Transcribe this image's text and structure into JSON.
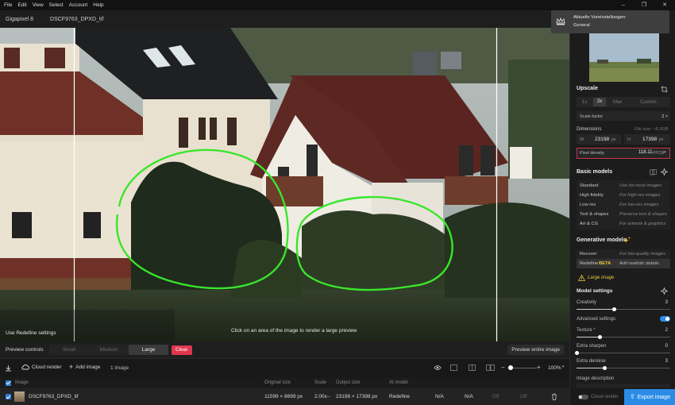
{
  "menu": [
    "File",
    "Edit",
    "View",
    "Select",
    "Account",
    "Help"
  ],
  "window_controls": [
    "–",
    "❐",
    "✕"
  ],
  "app": {
    "name": "Gigapixel 8",
    "filename": "DSCF9763_DPXD_tif"
  },
  "toast": {
    "title": "Aktuelle Voreinstellungen:",
    "subtitle": "General"
  },
  "preview": {
    "bottom_left_hint": "Use Redefine settings",
    "center_hint": "Click on an area of the image to render a large preview"
  },
  "preview_controls": {
    "label": "Preview controls",
    "sizes": [
      "Small",
      "Medium",
      "Large"
    ],
    "active_size": "Large",
    "clear": "Clear",
    "preview_entire": "Preview entire image"
  },
  "toolbar": {
    "cloud_render": "Cloud render",
    "add_image": "Add image",
    "count": "1 image",
    "zoom": "100%"
  },
  "table": {
    "headers": [
      "Image",
      "Original size",
      "Scale",
      "Output size",
      "AI model"
    ],
    "row": {
      "name": "DSCF9763_DPXD_tif",
      "original": "11599 × 8699 px",
      "scale": "2.00x",
      "output": "23198 × 17398 px",
      "model": "Redefine",
      "c1": "N/A",
      "c2": "N/A",
      "c3": "Off",
      "c4": "Off"
    }
  },
  "panel": {
    "upscale_title": "Upscale",
    "scale_options": [
      "1x",
      "2x",
      "Max",
      "Custom"
    ],
    "active_scale": "2x",
    "scale_factor_label": "Scale factor",
    "scale_factor_value": "2 ×",
    "dimensions_label": "Dimensions",
    "file_size": "File size: ~8.2GB",
    "w_label": "W",
    "w_value": "23198",
    "h_label": "H",
    "h_value": "17398",
    "unit": "px",
    "pixel_density_label": "Pixel density",
    "pixel_density_value": "118.11",
    "pixel_density_unit": "PPCM",
    "basic_title": "Basic models",
    "basic_models": [
      {
        "name": "Standard",
        "desc": "Use for most images"
      },
      {
        "name": "High fidelity",
        "desc": "For high-res images"
      },
      {
        "name": "Low res",
        "desc": "For low-res images"
      },
      {
        "name": "Text & shapes",
        "desc": "Preserve text & shapes"
      },
      {
        "name": "Art & CG",
        "desc": "For artwork & graphics"
      }
    ],
    "gen_title": "Generative models",
    "gen_models": [
      {
        "name": "Recover",
        "desc": "For low-quality images"
      },
      {
        "name": "Redefine",
        "badge": "BETA",
        "desc": "Add realistic details"
      }
    ],
    "warning": "Large image",
    "model_settings": "Model settings",
    "creativity_label": "Creativity",
    "creativity_value": "3",
    "creativity_level": 0.4,
    "advanced_label": "Advanced settings",
    "texture_label": "Texture",
    "texture_value": "2",
    "texture_level": 0.25,
    "sharpen_label": "Extra sharpen",
    "sharpen_value": "0",
    "sharpen_level": 0.0,
    "denoise_label": "Extra denoise",
    "denoise_value": "3",
    "denoise_level": 0.3,
    "image_description": "Image description",
    "cloud_render": "Cloud render",
    "export": "Export image"
  },
  "colors": {
    "accent": "#2b8ce6",
    "clear": "#e0364f",
    "annotation": "#39e62b",
    "beta": "#e8c93a",
    "warning": "#e8c93a"
  }
}
